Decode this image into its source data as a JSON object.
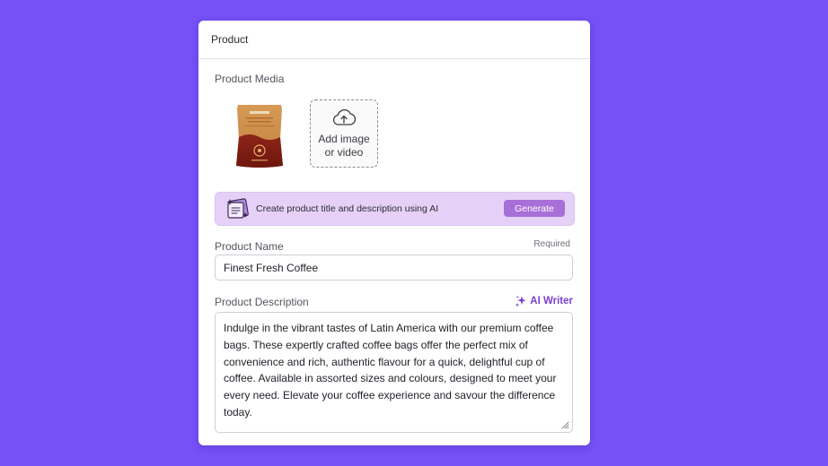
{
  "card": {
    "title": "Product"
  },
  "media": {
    "label": "Product Media",
    "add_line1": "Add image",
    "add_line2": "or video"
  },
  "ai_banner": {
    "text": "Create product title and description using AI",
    "generate_label": "Generate"
  },
  "product_name": {
    "label": "Product Name",
    "required_label": "Required",
    "value": "Finest Fresh Coffee"
  },
  "product_description": {
    "label": "Product Description",
    "ai_writer_label": "AI Writer",
    "value": "Indulge in the vibrant tastes of Latin America with our premium coffee bags. These expertly crafted coffee bags offer the perfect mix of convenience and rich, authentic flavour for a quick, delightful cup of coffee. Available in assorted sizes and colours, designed to meet your every need. Elevate your coffee experience and savour the difference today."
  },
  "colors": {
    "background": "#7551f6",
    "accent": "#a86fd8",
    "ai_banner_bg": "#e5d1f7",
    "ai_writer": "#7a3fd1"
  }
}
